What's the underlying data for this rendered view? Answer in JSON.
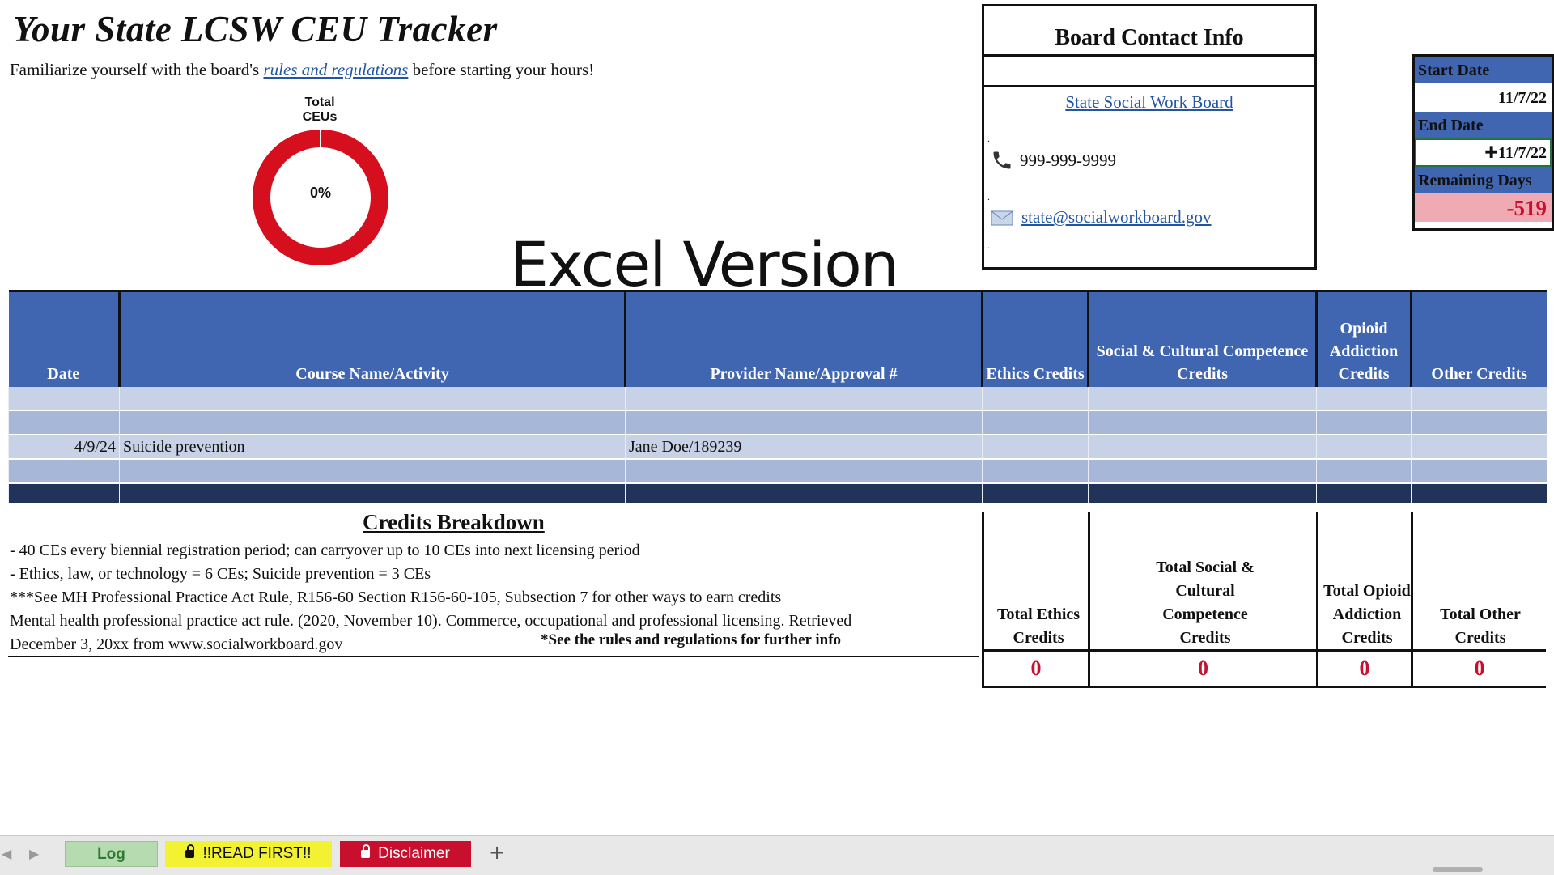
{
  "title": "Your State LCSW CEU Tracker",
  "subtitle": {
    "before": "Familiarize yourself with the board's ",
    "link": "rules and regulations",
    "after": " before starting your hours!"
  },
  "chart_data": {
    "type": "pie",
    "title": "Total CEUs",
    "center_label": "0%",
    "values": [
      0,
      100
    ],
    "colors": [
      "#4166b1",
      "#d60f1f"
    ]
  },
  "overlay_text": "Excel Version",
  "board": {
    "heading": "Board Contact Info",
    "link": "State Social Work Board",
    "phone": "999-999-9999",
    "email": "state@socialworkboard.gov"
  },
  "dates": {
    "start_label": "Start Date",
    "start_value": "11/7/22",
    "end_label": "End Date",
    "end_value": "11/7/22",
    "remaining_label": "Remaining Days",
    "remaining_value": "-519"
  },
  "table": {
    "headers": {
      "date": "Date",
      "course": "Course Name/Activity",
      "provider": "Provider Name/Approval #",
      "ethics": "Ethics Credits",
      "social": "Social & Cultural Competence Credits",
      "opioid": "Opioid Addiction Credits",
      "other": "Other Credits"
    },
    "entry": {
      "date": "4/9/24",
      "course": "Suicide prevention",
      "provider": "Jane Doe/189239"
    }
  },
  "breakdown": {
    "title": "Credits Breakdown",
    "line1": "- 40 CEs every biennial registration period; can carryover up to 10 CEs into next licensing period",
    "line2": "- Ethics, law, or technology = 6 CEs; Suicide prevention = 3 CEs",
    "line3": "***See MH Professional Practice Act Rule, R156-60 Section R156-60-105, Subsection 7 for other ways to earn credits",
    "line4": "Mental health professional practice act rule. (2020, November 10). Commerce, occupational and professional licensing. Retrieved",
    "line5": "December 3, 20xx from www.socialworkboard.gov",
    "note": "*See the rules and regulations for further info"
  },
  "totals": {
    "ethics": {
      "label": "Total Ethics Credits",
      "value": "0"
    },
    "social": {
      "label": "Total Social & Cultural Competence Credits",
      "value": "0"
    },
    "opioid": {
      "label": "Total Opioid Addiction Credits",
      "value": "0"
    },
    "other": {
      "label": "Total Other Credits",
      "value": "0"
    }
  },
  "sheet_tabs": {
    "log": "Log",
    "read_first": "!!READ FIRST!!",
    "disclaimer": "Disclaimer",
    "add": "+"
  },
  "colors": {
    "header_blue": "#4166b1",
    "red": "#c8102e",
    "row_light": "#c7d2e6",
    "row_dark": "#a6b7d8",
    "remaining_bg": "#efaab3"
  }
}
